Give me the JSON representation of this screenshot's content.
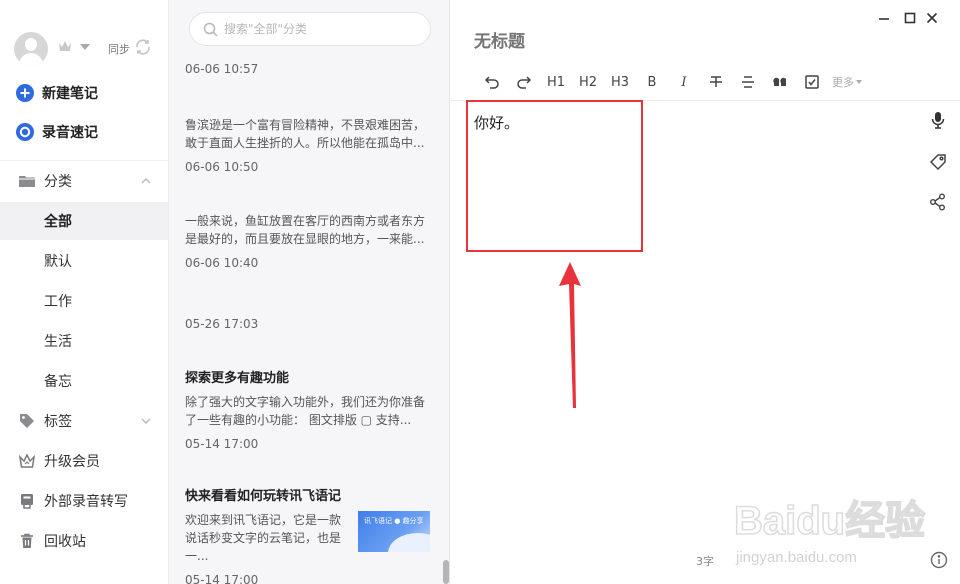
{
  "sidebar": {
    "sync_label": "同步",
    "actions": [
      {
        "label": "新建笔记",
        "icon": "plus-circle-icon"
      },
      {
        "label": "录音速记",
        "icon": "record-circle-icon"
      }
    ],
    "category_header": {
      "label": "分类",
      "icon": "folder-icon",
      "expanded": true
    },
    "categories": [
      {
        "label": "全部",
        "active": true
      },
      {
        "label": "默认"
      },
      {
        "label": "工作"
      },
      {
        "label": "生活"
      },
      {
        "label": "备忘"
      }
    ],
    "tags": {
      "label": "标签",
      "icon": "tag-icon"
    },
    "upgrade": {
      "label": "升级会员",
      "icon": "crown-icon"
    },
    "transcribe": {
      "label": "外部录音转写",
      "icon": "recorder-icon"
    },
    "trash": {
      "label": "回收站",
      "icon": "trash-icon"
    }
  },
  "note_list": {
    "search_placeholder": "搜索\"全部\"分类",
    "notes": [
      {
        "title": "",
        "summary": "",
        "date": "06-06 10:57"
      },
      {
        "title": "",
        "summary": "鲁滨逊是一个富有冒险精神，不畏艰难困苦，敢于直面人生挫折的人。所以他能在孤岛中...",
        "date": "06-06 10:50"
      },
      {
        "title": "",
        "summary": "一般来说，鱼缸放置在客厅的西南方或者东方是最好的，而且要放在显眼的地方，一来能...",
        "date": "06-06 10:40"
      },
      {
        "title": "",
        "summary": "",
        "date": "05-26 17:03"
      },
      {
        "title": "探索更多有趣功能",
        "summary": "除了强大的文字输入功能外，我们还为你准备了一些有趣的小功能：  图文排版 ▢ 支持...",
        "date": "05-14 17:00"
      },
      {
        "title": "快来看看如何玩转讯飞语记",
        "summary": "欢迎来到讯飞语记，它是一款说话秒变文字的云笔记，也是一...",
        "date": "05-14 17:00",
        "thumb_caption": "讯飞语记 ● 趣分享"
      }
    ]
  },
  "editor": {
    "title_placeholder": "无标题",
    "toolbar": [
      "undo-icon",
      "redo-icon",
      "H1",
      "H2",
      "H3",
      "B",
      "I",
      "strikethrough-icon",
      "align-icon",
      "quote-icon",
      "checkbox-icon"
    ],
    "more_label": "更多",
    "content": "你好。",
    "word_count": "3字",
    "side_icons": [
      "microphone-icon",
      "tag-outline-icon",
      "share-icon"
    ],
    "highlight_color": "#e8323c"
  },
  "watermark": {
    "text": "Baidu经验",
    "subtext": "jingyan.baidu.com"
  },
  "colors": {
    "accent": "#2f6be0",
    "arrow": "#e8323c"
  }
}
